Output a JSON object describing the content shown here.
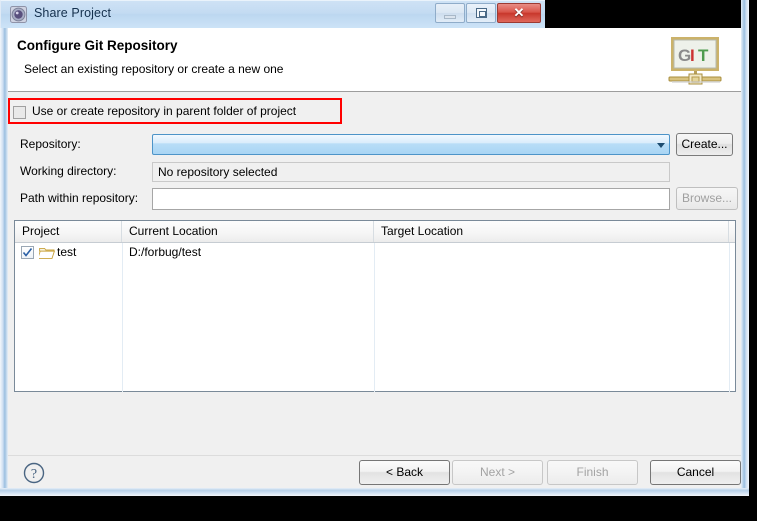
{
  "window": {
    "title": "Share Project",
    "icon": "share-project-icon",
    "controls": {
      "minimize": "minimize-icon",
      "maximize": "restore-icon",
      "close": "✕"
    }
  },
  "header": {
    "title": "Configure Git Repository",
    "subtitle": "Select an existing repository or create a new one",
    "logo": {
      "name": "git-logo",
      "letters": [
        "G",
        "I",
        "T"
      ],
      "colors": [
        "#8b8b8b",
        "#cc3333",
        "#4f9b4f"
      ],
      "frame_color": "#c9a63c",
      "plate_color": "#eef1ea"
    }
  },
  "options": {
    "parent_folder_checkbox": {
      "label": "Use or create repository in parent folder of project",
      "checked": false
    },
    "highlight_color": "#ff0000"
  },
  "form": {
    "repository": {
      "label": "Repository:",
      "value": "",
      "placeholder": "",
      "create_button": "Create..."
    },
    "working_directory": {
      "label": "Working directory:",
      "value": "No repository selected"
    },
    "path_within_repository": {
      "label": "Path within repository:",
      "value": "",
      "placeholder": "",
      "browse_button": "Browse...",
      "browse_enabled": false
    }
  },
  "table": {
    "columns": [
      "Project",
      "Current Location",
      "Target Location",
      ""
    ],
    "rows": [
      {
        "checked": true,
        "icon": "folder-icon",
        "project": "test",
        "current_location": "D:/forbug/test",
        "target_location": ""
      }
    ]
  },
  "footer": {
    "help": "?",
    "buttons": [
      {
        "label": "< Back",
        "enabled": true
      },
      {
        "label": "Next >",
        "enabled": false
      },
      {
        "label": "Finish",
        "enabled": false
      },
      {
        "label": "Cancel",
        "enabled": true
      }
    ]
  }
}
